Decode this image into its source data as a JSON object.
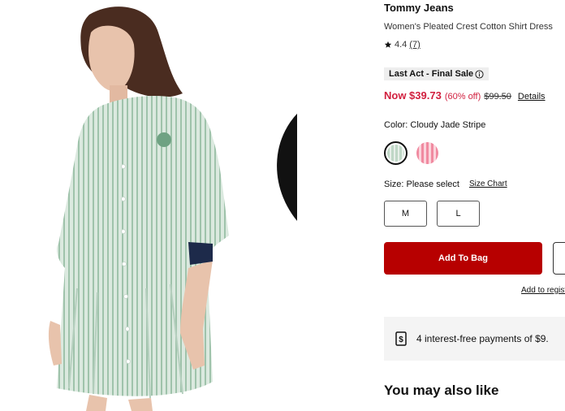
{
  "product": {
    "brand": "Tommy Jeans",
    "title": "Women's Pleated Crest Cotton Shirt Dress",
    "rating_value": "4.4",
    "rating_count": "(7)",
    "image_alt": "Tommy Jeans Women's Pleated Crest Cotton Shirt Dress"
  },
  "pricing": {
    "sale_tag": "Last Act - Final Sale",
    "now_price": "Now $39.73",
    "percent_off": "(60% off)",
    "was_price": "$99.50",
    "details_link": "Details"
  },
  "color": {
    "label": "Color: Cloudy Jade Stripe",
    "swatches": [
      "Cloudy Jade Stripe",
      "Pink Stripe"
    ]
  },
  "size": {
    "label": "Size: Please select",
    "chart_link": "Size Chart",
    "options": [
      "M",
      "L"
    ]
  },
  "actions": {
    "add_to_bag": "Add To Bag",
    "add_to_registry": "Add to registry"
  },
  "payments": {
    "text": "4 interest-free payments of $9."
  },
  "recommendations": {
    "heading": "You may also like"
  },
  "icons": {
    "favorite": "heart-outline-icon",
    "rating": "star-icon",
    "info": "info-circle-icon",
    "payment": "dollar-receipt-icon"
  }
}
